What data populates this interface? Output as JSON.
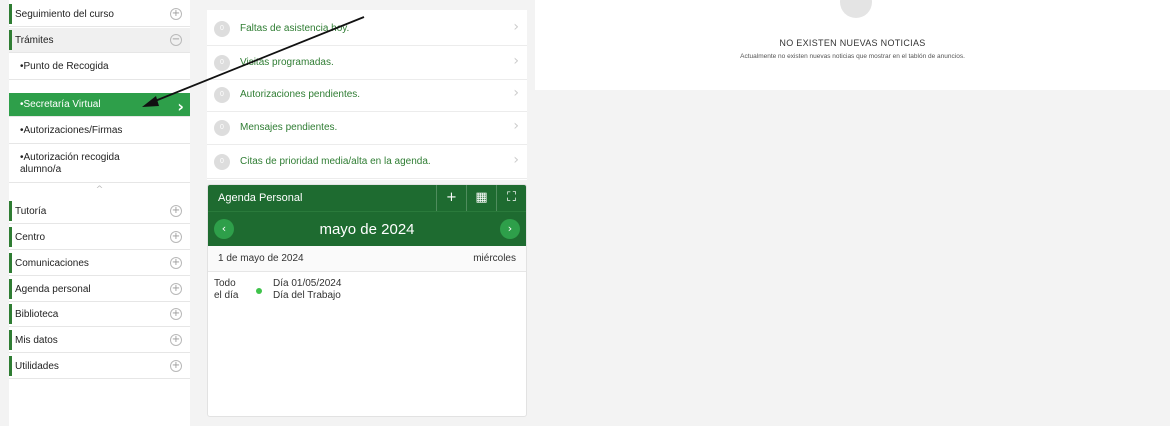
{
  "sidebar": {
    "groups": [
      {
        "label": "Seguimiento del curso",
        "expanded": false
      },
      {
        "label": "Trámites",
        "expanded": true
      }
    ],
    "subitems": [
      {
        "label": "•Punto de Recogida"
      },
      {
        "label": "•Secretaría Virtual",
        "active": true
      },
      {
        "label": "•Autorizaciones/Firmas"
      },
      {
        "label": "•Autorización recogida alumno/a"
      }
    ],
    "groups_after": [
      {
        "label": "Tutoría"
      },
      {
        "label": "Centro"
      },
      {
        "label": "Comunicaciones"
      },
      {
        "label": "Agenda personal"
      },
      {
        "label": "Biblioteca"
      },
      {
        "label": "Mis datos"
      },
      {
        "label": "Utilidades"
      }
    ]
  },
  "list": [
    {
      "count": "0",
      "label": "Faltas de asistencia hoy."
    },
    {
      "count": "0",
      "label": "Visitas programadas."
    },
    {
      "count": "0",
      "label": "Autorizaciones pendientes."
    },
    {
      "count": "0",
      "label": "Mensajes pendientes."
    },
    {
      "count": "0",
      "label": "Citas de prioridad media/alta en la agenda."
    }
  ],
  "agenda": {
    "title": "Agenda Personal",
    "month": "mayo de 2024",
    "day_date": "1 de mayo de 2024",
    "day_name": "miércoles",
    "event_when_line1": "Todo",
    "event_when_line2": "el día",
    "event_line1": "Día 01/05/2024",
    "event_line2": "Día del Trabajo"
  },
  "news": {
    "title": "NO EXISTEN NUEVAS NOTICIAS",
    "subtitle": "Actualmente no existen nuevas noticias que mostrar en el tablón de anuncios."
  },
  "colors": {
    "brand_green": "#1e6b30",
    "active_green": "#2e9f4a",
    "event_dot": "#3fc34b"
  }
}
